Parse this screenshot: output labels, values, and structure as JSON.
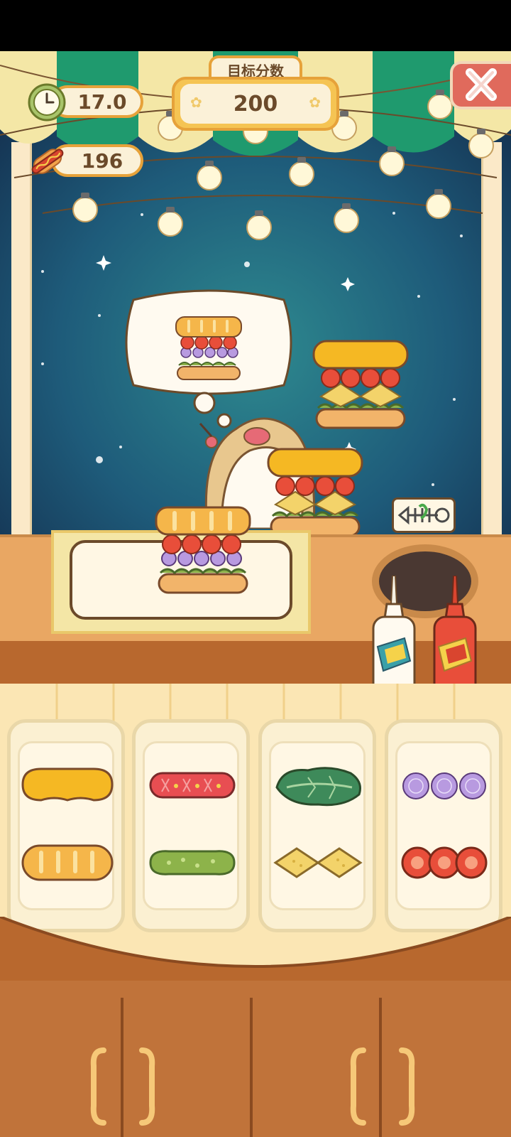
{
  "hud": {
    "timer": "17.0",
    "sausages": "196"
  },
  "target": {
    "label": "目标分数",
    "score": "200"
  },
  "trash_label_icon": "fish-bone-icon",
  "ingredients": [
    "cheese",
    "baguette-top",
    "salami",
    "pickle",
    "lettuce",
    "cheese-slices",
    "purple-onion",
    "tomato"
  ],
  "colors": {
    "awning_green": "#1f9a6e",
    "awning_yellow": "#f4e7a6",
    "hud_orange": "#e6a23a",
    "close_red": "#e06a5c",
    "counter": "#e9a763"
  }
}
